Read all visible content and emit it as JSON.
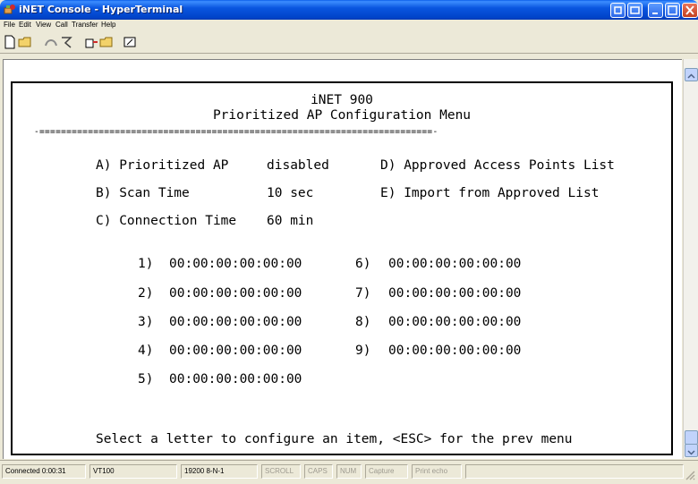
{
  "window": {
    "title": "iNET Console - HyperTerminal",
    "title_color": "#0a56e0"
  },
  "menu": [
    "File",
    "Edit",
    "View",
    "Call",
    "Transfer",
    "Help"
  ],
  "toolbar": {
    "icons": [
      "new-connection-icon",
      "open-icon",
      "disconnect-icon",
      "dial-icon",
      "send-icon",
      "receive-icon",
      "properties-icon"
    ]
  },
  "terminal": {
    "header_line1": "iNET 900",
    "header_line2": "Prioritized AP Configuration Menu",
    "separator": "-=========================================================================-",
    "options_left": [
      {
        "label": "A) Prioritized AP",
        "value": "disabled"
      },
      {
        "label": "B) Scan Time",
        "value": "10 sec"
      },
      {
        "label": "C) Connection Time",
        "value": "60 min"
      }
    ],
    "options_right": [
      "D) Approved Access Points List",
      "E) Import from Approved List"
    ],
    "addresses_left": [
      {
        "index": "1)",
        "mac": "00:00:00:00:00:00"
      },
      {
        "index": "2)",
        "mac": "00:00:00:00:00:00"
      },
      {
        "index": "3)",
        "mac": "00:00:00:00:00:00"
      },
      {
        "index": "4)",
        "mac": "00:00:00:00:00:00"
      },
      {
        "index": "5)",
        "mac": "00:00:00:00:00:00"
      }
    ],
    "addresses_right": [
      {
        "index": "6)",
        "mac": "00:00:00:00:00:00"
      },
      {
        "index": "7)",
        "mac": "00:00:00:00:00:00"
      },
      {
        "index": "8)",
        "mac": "00:00:00:00:00:00"
      },
      {
        "index": "9)",
        "mac": "00:00:00:00:00:00"
      }
    ],
    "prompt": "Select a letter to configure an item, <ESC> for the prev menu"
  },
  "statusbar": {
    "connected": "Connected 0:00:31",
    "emulation": "VT100",
    "settings": "19200 8-N-1",
    "scroll": "SCROLL",
    "caps": "CAPS",
    "num": "NUM",
    "capture": "Capture",
    "print_echo": "Print echo"
  }
}
